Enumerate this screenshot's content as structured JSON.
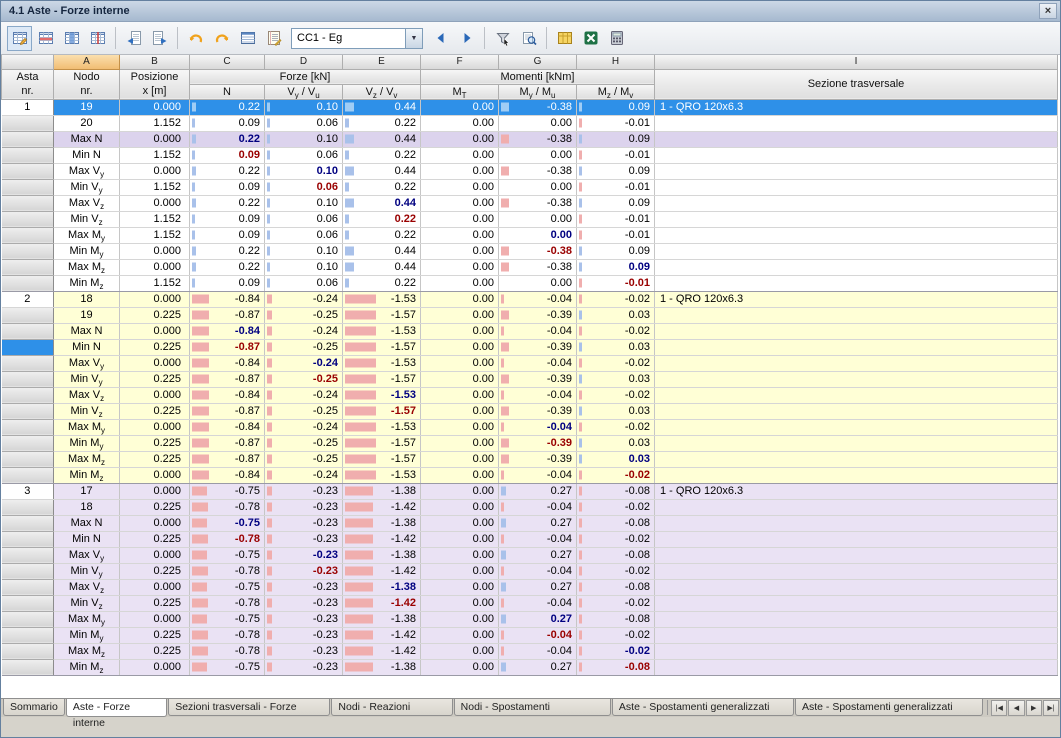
{
  "window": {
    "title": "4.1 Aste - Forze interne"
  },
  "icons": {
    "close": "×",
    "combo_arrow": "▼"
  },
  "toolbar": {
    "combo_value": "CC1 - Eg"
  },
  "colors": {
    "selection_blue": "#2e90e8",
    "group_yellow": "#ffffd6",
    "group_purple": "#eae2f4",
    "tint_row": "#dcd3ed",
    "bar_positive": "#a9c1ea",
    "bar_negative": "#f0aeae",
    "max_value_text": "#000080",
    "min_value_text": "#990000",
    "selected_column_header": "#f1bd74"
  },
  "table": {
    "letters": [
      "A",
      "B",
      "C",
      "D",
      "E",
      "F",
      "G",
      "H",
      "I"
    ],
    "header": {
      "asta": [
        "Asta",
        "nr."
      ],
      "nodo": [
        "Nodo",
        "nr."
      ],
      "posizione": [
        "Posizione",
        "x [m]"
      ],
      "forze": "Forze [kN]",
      "momenti": "Momenti [kNm]",
      "sezione": "Sezione trasversale",
      "n": [
        {
          "t": "N"
        }
      ],
      "vy": [
        {
          "t": "V"
        },
        {
          "sub": "y"
        },
        {
          "t": " / V"
        },
        {
          "sub": "u"
        }
      ],
      "vz": [
        {
          "t": "V"
        },
        {
          "sub": "z"
        },
        {
          "t": " / V"
        },
        {
          "sub": "v"
        }
      ],
      "mt": [
        {
          "t": "M"
        },
        {
          "sub": "T"
        }
      ],
      "my": [
        {
          "t": "M"
        },
        {
          "sub": "y"
        },
        {
          "t": " / M"
        },
        {
          "sub": "u"
        }
      ],
      "mz": [
        {
          "t": "M"
        },
        {
          "sub": "z"
        },
        {
          "t": " / M"
        },
        {
          "sub": "v"
        }
      ]
    },
    "groups": [
      {
        "member": "1",
        "section": "1 - QRO 120x6.3",
        "color": "white",
        "rows": [
          {
            "l": [
              {
                "t": "19"
              }
            ],
            "x": "0.000",
            "v": [
              "0.22",
              "0.10",
              "0.44",
              "0.00",
              "-0.38",
              "0.09"
            ],
            "sel": true
          },
          {
            "l": [
              {
                "t": "20"
              }
            ],
            "x": "1.152",
            "v": [
              "0.09",
              "0.06",
              "0.22",
              "0.00",
              "0.00",
              "-0.01"
            ]
          },
          {
            "l": [
              {
                "t": "Max N"
              }
            ],
            "x": "0.000",
            "v": [
              "0.22",
              "0.10",
              "0.44",
              "0.00",
              "-0.38",
              "0.09"
            ],
            "b": 0,
            "k": "max",
            "tint": true
          },
          {
            "l": [
              {
                "t": "Min N"
              }
            ],
            "x": "1.152",
            "v": [
              "0.09",
              "0.06",
              "0.22",
              "0.00",
              "0.00",
              "-0.01"
            ],
            "b": 0,
            "k": "min"
          },
          {
            "l": [
              {
                "t": "Max V"
              },
              {
                "sub": "y"
              }
            ],
            "x": "0.000",
            "v": [
              "0.22",
              "0.10",
              "0.44",
              "0.00",
              "-0.38",
              "0.09"
            ],
            "b": 1,
            "k": "max"
          },
          {
            "l": [
              {
                "t": "Min V"
              },
              {
                "sub": "y"
              }
            ],
            "x": "1.152",
            "v": [
              "0.09",
              "0.06",
              "0.22",
              "0.00",
              "0.00",
              "-0.01"
            ],
            "b": 1,
            "k": "min"
          },
          {
            "l": [
              {
                "t": "Max V"
              },
              {
                "sub": "z"
              }
            ],
            "x": "0.000",
            "v": [
              "0.22",
              "0.10",
              "0.44",
              "0.00",
              "-0.38",
              "0.09"
            ],
            "b": 2,
            "k": "max"
          },
          {
            "l": [
              {
                "t": "Min V"
              },
              {
                "sub": "z"
              }
            ],
            "x": "1.152",
            "v": [
              "0.09",
              "0.06",
              "0.22",
              "0.00",
              "0.00",
              "-0.01"
            ],
            "b": 2,
            "k": "min"
          },
          {
            "l": [
              {
                "t": "Max M"
              },
              {
                "sub": "y"
              }
            ],
            "x": "1.152",
            "v": [
              "0.09",
              "0.06",
              "0.22",
              "0.00",
              "0.00",
              "-0.01"
            ],
            "b": 4,
            "k": "max"
          },
          {
            "l": [
              {
                "t": "Min M"
              },
              {
                "sub": "y"
              }
            ],
            "x": "0.000",
            "v": [
              "0.22",
              "0.10",
              "0.44",
              "0.00",
              "-0.38",
              "0.09"
            ],
            "b": 4,
            "k": "min"
          },
          {
            "l": [
              {
                "t": "Max M"
              },
              {
                "sub": "z"
              }
            ],
            "x": "0.000",
            "v": [
              "0.22",
              "0.10",
              "0.44",
              "0.00",
              "-0.38",
              "0.09"
            ],
            "b": 5,
            "k": "max"
          },
          {
            "l": [
              {
                "t": "Min M"
              },
              {
                "sub": "z"
              }
            ],
            "x": "1.152",
            "v": [
              "0.09",
              "0.06",
              "0.22",
              "0.00",
              "0.00",
              "-0.01"
            ],
            "b": 5,
            "k": "min"
          }
        ]
      },
      {
        "member": "2",
        "section": "1 - QRO 120x6.3",
        "color": "yellow",
        "rows": [
          {
            "l": [
              {
                "t": "18"
              }
            ],
            "x": "0.000",
            "v": [
              "-0.84",
              "-0.24",
              "-1.53",
              "0.00",
              "-0.04",
              "-0.02"
            ]
          },
          {
            "l": [
              {
                "t": "19"
              }
            ],
            "x": "0.225",
            "v": [
              "-0.87",
              "-0.25",
              "-1.57",
              "0.00",
              "-0.39",
              "0.03"
            ]
          },
          {
            "l": [
              {
                "t": "Max N"
              }
            ],
            "x": "0.000",
            "v": [
              "-0.84",
              "-0.24",
              "-1.53",
              "0.00",
              "-0.04",
              "-0.02"
            ],
            "b": 0,
            "k": "max"
          },
          {
            "l": [
              {
                "t": "Min N"
              }
            ],
            "x": "0.225",
            "v": [
              "-0.87",
              "-0.25",
              "-1.57",
              "0.00",
              "-0.39",
              "0.03"
            ],
            "b": 0,
            "k": "min",
            "cur": true
          },
          {
            "l": [
              {
                "t": "Max V"
              },
              {
                "sub": "y"
              }
            ],
            "x": "0.000",
            "v": [
              "-0.84",
              "-0.24",
              "-1.53",
              "0.00",
              "-0.04",
              "-0.02"
            ],
            "b": 1,
            "k": "max"
          },
          {
            "l": [
              {
                "t": "Min V"
              },
              {
                "sub": "y"
              }
            ],
            "x": "0.225",
            "v": [
              "-0.87",
              "-0.25",
              "-1.57",
              "0.00",
              "-0.39",
              "0.03"
            ],
            "b": 1,
            "k": "min"
          },
          {
            "l": [
              {
                "t": "Max V"
              },
              {
                "sub": "z"
              }
            ],
            "x": "0.000",
            "v": [
              "-0.84",
              "-0.24",
              "-1.53",
              "0.00",
              "-0.04",
              "-0.02"
            ],
            "b": 2,
            "k": "max"
          },
          {
            "l": [
              {
                "t": "Min V"
              },
              {
                "sub": "z"
              }
            ],
            "x": "0.225",
            "v": [
              "-0.87",
              "-0.25",
              "-1.57",
              "0.00",
              "-0.39",
              "0.03"
            ],
            "b": 2,
            "k": "min"
          },
          {
            "l": [
              {
                "t": "Max M"
              },
              {
                "sub": "y"
              }
            ],
            "x": "0.000",
            "v": [
              "-0.84",
              "-0.24",
              "-1.53",
              "0.00",
              "-0.04",
              "-0.02"
            ],
            "b": 4,
            "k": "max"
          },
          {
            "l": [
              {
                "t": "Min M"
              },
              {
                "sub": "y"
              }
            ],
            "x": "0.225",
            "v": [
              "-0.87",
              "-0.25",
              "-1.57",
              "0.00",
              "-0.39",
              "0.03"
            ],
            "b": 4,
            "k": "min"
          },
          {
            "l": [
              {
                "t": "Max M"
              },
              {
                "sub": "z"
              }
            ],
            "x": "0.225",
            "v": [
              "-0.87",
              "-0.25",
              "-1.57",
              "0.00",
              "-0.39",
              "0.03"
            ],
            "b": 5,
            "k": "max"
          },
          {
            "l": [
              {
                "t": "Min M"
              },
              {
                "sub": "z"
              }
            ],
            "x": "0.000",
            "v": [
              "-0.84",
              "-0.24",
              "-1.53",
              "0.00",
              "-0.04",
              "-0.02"
            ],
            "b": 5,
            "k": "min"
          }
        ]
      },
      {
        "member": "3",
        "section": "1 - QRO 120x6.3",
        "color": "purple",
        "rows": [
          {
            "l": [
              {
                "t": "17"
              }
            ],
            "x": "0.000",
            "v": [
              "-0.75",
              "-0.23",
              "-1.38",
              "0.00",
              "0.27",
              "-0.08"
            ]
          },
          {
            "l": [
              {
                "t": "18"
              }
            ],
            "x": "0.225",
            "v": [
              "-0.78",
              "-0.23",
              "-1.42",
              "0.00",
              "-0.04",
              "-0.02"
            ]
          },
          {
            "l": [
              {
                "t": "Max N"
              }
            ],
            "x": "0.000",
            "v": [
              "-0.75",
              "-0.23",
              "-1.38",
              "0.00",
              "0.27",
              "-0.08"
            ],
            "b": 0,
            "k": "max"
          },
          {
            "l": [
              {
                "t": "Min N"
              }
            ],
            "x": "0.225",
            "v": [
              "-0.78",
              "-0.23",
              "-1.42",
              "0.00",
              "-0.04",
              "-0.02"
            ],
            "b": 0,
            "k": "min"
          },
          {
            "l": [
              {
                "t": "Max V"
              },
              {
                "sub": "y"
              }
            ],
            "x": "0.000",
            "v": [
              "-0.75",
              "-0.23",
              "-1.38",
              "0.00",
              "0.27",
              "-0.08"
            ],
            "b": 1,
            "k": "max"
          },
          {
            "l": [
              {
                "t": "Min V"
              },
              {
                "sub": "y"
              }
            ],
            "x": "0.225",
            "v": [
              "-0.78",
              "-0.23",
              "-1.42",
              "0.00",
              "-0.04",
              "-0.02"
            ],
            "b": 1,
            "k": "min"
          },
          {
            "l": [
              {
                "t": "Max V"
              },
              {
                "sub": "z"
              }
            ],
            "x": "0.000",
            "v": [
              "-0.75",
              "-0.23",
              "-1.38",
              "0.00",
              "0.27",
              "-0.08"
            ],
            "b": 2,
            "k": "max"
          },
          {
            "l": [
              {
                "t": "Min V"
              },
              {
                "sub": "z"
              }
            ],
            "x": "0.225",
            "v": [
              "-0.78",
              "-0.23",
              "-1.42",
              "0.00",
              "-0.04",
              "-0.02"
            ],
            "b": 2,
            "k": "min"
          },
          {
            "l": [
              {
                "t": "Max M"
              },
              {
                "sub": "y"
              }
            ],
            "x": "0.000",
            "v": [
              "-0.75",
              "-0.23",
              "-1.38",
              "0.00",
              "0.27",
              "-0.08"
            ],
            "b": 4,
            "k": "max"
          },
          {
            "l": [
              {
                "t": "Min M"
              },
              {
                "sub": "y"
              }
            ],
            "x": "0.225",
            "v": [
              "-0.78",
              "-0.23",
              "-1.42",
              "0.00",
              "-0.04",
              "-0.02"
            ],
            "b": 4,
            "k": "min"
          },
          {
            "l": [
              {
                "t": "Max M"
              },
              {
                "sub": "z"
              }
            ],
            "x": "0.225",
            "v": [
              "-0.78",
              "-0.23",
              "-1.42",
              "0.00",
              "-0.04",
              "-0.02"
            ],
            "b": 5,
            "k": "max"
          },
          {
            "l": [
              {
                "t": "Min M"
              },
              {
                "sub": "z"
              }
            ],
            "x": "0.000",
            "v": [
              "-0.75",
              "-0.23",
              "-1.38",
              "0.00",
              "0.27",
              "-0.08"
            ],
            "b": 5,
            "k": "min"
          }
        ]
      }
    ]
  },
  "tabs": {
    "items": [
      "Sommario",
      "Aste - Forze interne",
      "Sezioni trasversali - Forze interne",
      "Nodi - Reazioni vincolari",
      "Nodi - Spostamenti generalizzati",
      "Aste - Spostamenti generalizzati locali",
      "Aste - Spostamenti generalizzati globali"
    ],
    "active_index": 1,
    "nav": [
      "|◀",
      "◀",
      "▶",
      "▶|"
    ]
  }
}
